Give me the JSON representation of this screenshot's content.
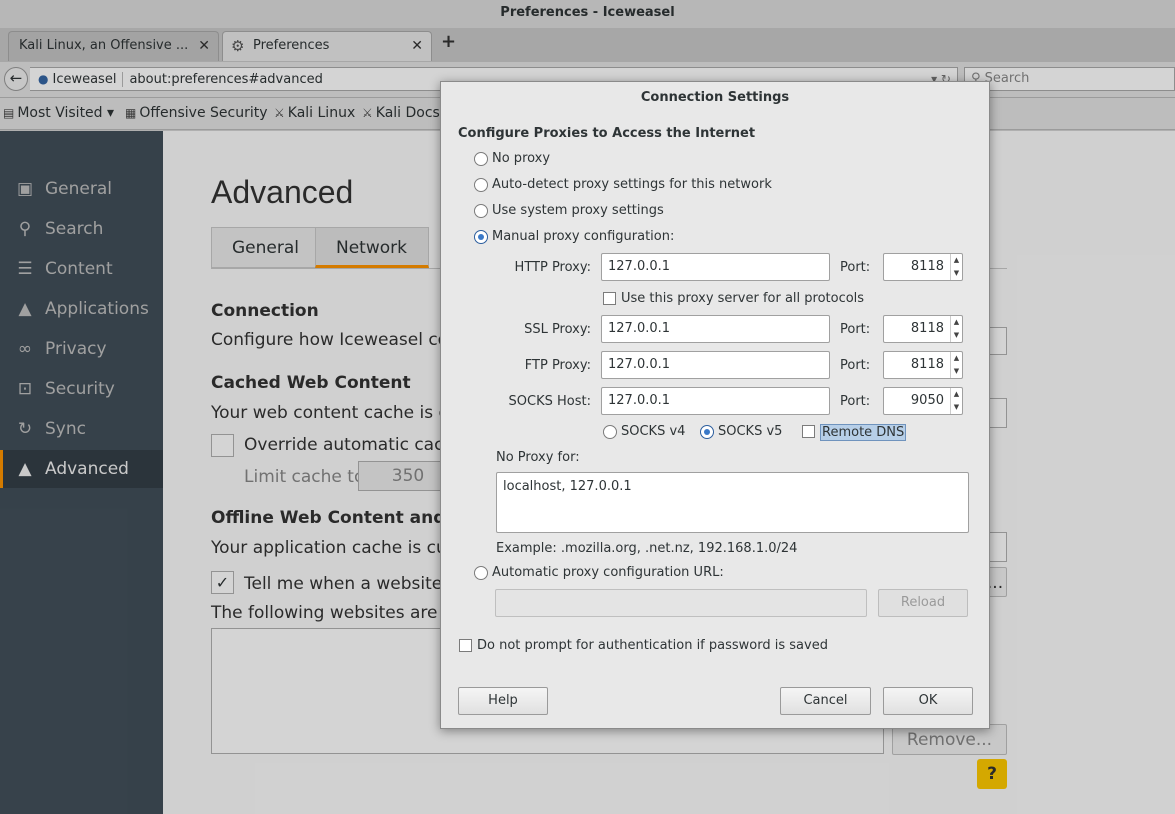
{
  "window": {
    "title": "Preferences - Iceweasel"
  },
  "tabs": [
    {
      "label": "Kali Linux, an Offensive ..."
    },
    {
      "label": "Preferences"
    }
  ],
  "navbar": {
    "site_label": "Iceweasel",
    "url": "about:preferences#advanced",
    "search_placeholder": "Search"
  },
  "bookmarks": [
    {
      "label": "Most Visited"
    },
    {
      "label": "Offensive Security"
    },
    {
      "label": "Kali Linux"
    },
    {
      "label": "Kali Docs"
    }
  ],
  "sidebar": {
    "items": [
      {
        "label": "General"
      },
      {
        "label": "Search"
      },
      {
        "label": "Content"
      },
      {
        "label": "Applications"
      },
      {
        "label": "Privacy"
      },
      {
        "label": "Security"
      },
      {
        "label": "Sync"
      },
      {
        "label": "Advanced"
      }
    ]
  },
  "page": {
    "title": "Advanced",
    "subtabs": [
      {
        "label": "General"
      },
      {
        "label": "Network"
      }
    ],
    "connection_header": "Connection",
    "connection_desc": "Configure how Iceweasel con",
    "cache_header": "Cached Web Content",
    "cache_desc": "Your web content cache is cu",
    "override_label": "Override automatic cache",
    "limit_label": "Limit cache to",
    "limit_value": "350",
    "offline_header": "Offline Web Content and",
    "offline_desc": "Your application cache is curr",
    "tell_me_label": "Tell me when a website a",
    "following_label": "The following websites are a",
    "remove_label": "Remove...",
    "help_label": "?",
    "settings_ellipsis": "..."
  },
  "dialog": {
    "title": "Connection Settings",
    "heading": "Configure Proxies to Access the Internet",
    "radio_no_proxy": "No proxy",
    "radio_auto_detect": "Auto-detect proxy settings for this network",
    "radio_system": "Use system proxy settings",
    "radio_manual": "Manual proxy configuration:",
    "http_label": "HTTP Proxy:",
    "http_value": "127.0.0.1",
    "port_label": "Port:",
    "http_port": "8118",
    "all_protocols_label": "Use this proxy server for all protocols",
    "ssl_label": "SSL Proxy:",
    "ssl_value": "127.0.0.1",
    "ssl_port": "8118",
    "ftp_label": "FTP Proxy:",
    "ftp_value": "127.0.0.1",
    "ftp_port": "8118",
    "socks_label": "SOCKS Host:",
    "socks_value": "127.0.0.1",
    "socks_port": "9050",
    "socks_v4": "SOCKS v4",
    "socks_v5": "SOCKS v5",
    "remote_dns": "Remote DNS",
    "no_proxy_label": "No Proxy for:",
    "no_proxy_value": "localhost, 127.0.0.1",
    "example": "Example: .mozilla.org, .net.nz, 192.168.1.0/24",
    "radio_auto_url": "Automatic proxy configuration URL:",
    "auto_url_value": "",
    "reload_label": "Reload",
    "no_prompt_label": "Do not prompt for authentication if password is saved",
    "help_button": "Help",
    "cancel_button": "Cancel",
    "ok_button": "OK"
  }
}
